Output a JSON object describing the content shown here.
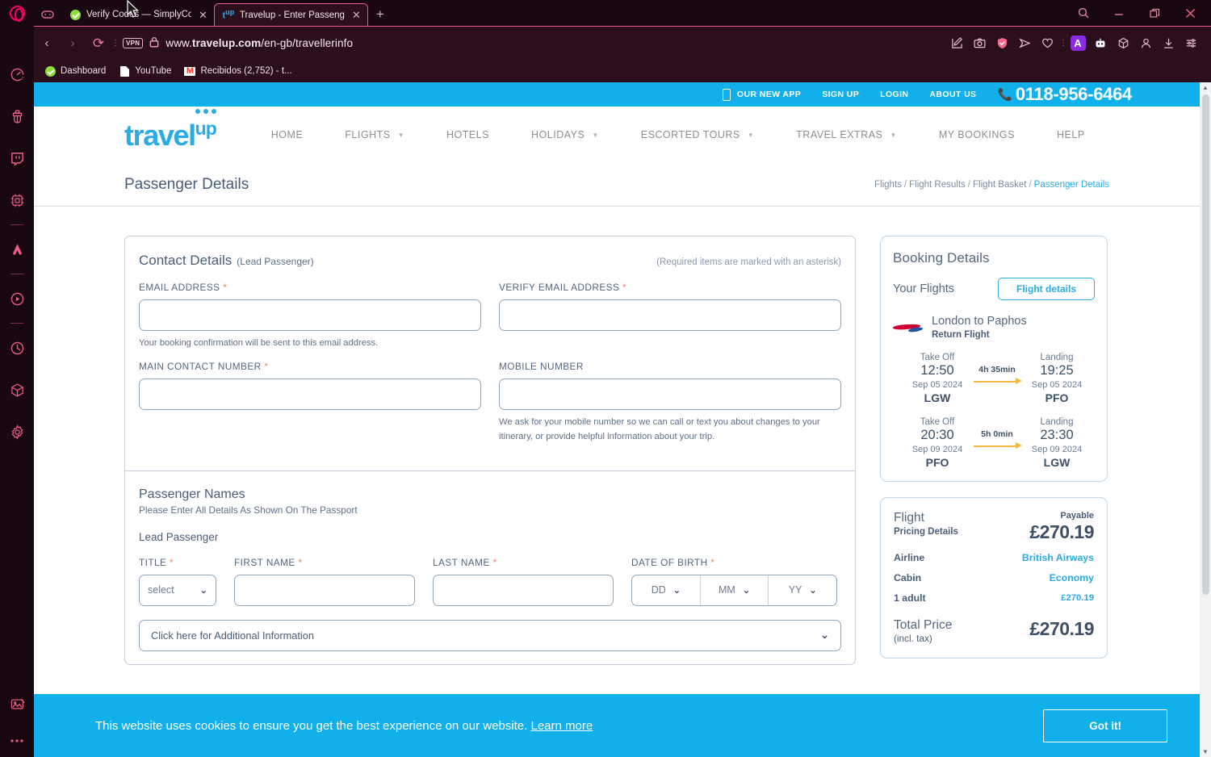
{
  "browser": {
    "tabs": [
      {
        "title": "Verify Codes — SimplyCod",
        "favicon": "green-check-icon",
        "active": false
      },
      {
        "title": "Travelup - Enter Passenger",
        "favicon": "travelup-icon",
        "active": true
      }
    ],
    "new_tab_label": "+",
    "window_controls": {
      "search": "search-icon",
      "minimize": "minimize-icon",
      "restore": "restore-icon",
      "close": "close-icon"
    },
    "nav": {
      "back": "back-icon",
      "forward": "forward-icon",
      "reload": "reload-icon",
      "vpn_badge": "VPN",
      "lock": "lock-icon",
      "url_prefix": "www.",
      "url_domain": "travelup.com",
      "url_path": "/en-gb/travellerinfo"
    },
    "bookmarks": [
      {
        "label": "Dashboard",
        "icon": "green-check-icon"
      },
      {
        "label": "YouTube",
        "icon": "document-icon"
      },
      {
        "label": "Recibidos (2,752) - t...",
        "icon": "gmail-icon"
      }
    ],
    "toolbar_icons": [
      "edit-page-icon",
      "snapshot-icon",
      "ad-block-shield-icon",
      "send-icon",
      "heart-icon",
      "extension-a-icon",
      "aria-bot-icon",
      "cube-icon",
      "profile-icon",
      "download-icon",
      "settings-sliders-icon"
    ],
    "sidebar_icons": [
      "speedometer-icon",
      "clean-brush-icon",
      "twitch-icon",
      "cpu-icon",
      "messenger-icon",
      "player-icon",
      "history-icon",
      "cube-icon",
      "gear-icon",
      "image-off-icon",
      "more-dots-icon"
    ]
  },
  "site": {
    "topbar": {
      "app_label": "OUR NEW APP",
      "signup": "SIGN UP",
      "login": "LOGIN",
      "about": "ABOUT US",
      "phone": "0118-956-6464"
    },
    "logo": {
      "travel": "travel",
      "up": "up"
    },
    "nav": [
      {
        "label": "HOME",
        "caret": false
      },
      {
        "label": "FLIGHTS",
        "caret": true
      },
      {
        "label": "HOTELS",
        "caret": false
      },
      {
        "label": "HOLIDAYS",
        "caret": true
      },
      {
        "label": "ESCORTED TOURS",
        "caret": true
      },
      {
        "label": "TRAVEL EXTRAS",
        "caret": true
      },
      {
        "label": "MY BOOKINGS",
        "caret": false
      },
      {
        "label": "HELP",
        "caret": false
      }
    ],
    "page_title": "Passenger Details",
    "breadcrumbs": [
      "Flights",
      "Flight Results",
      "Flight Basket",
      "Passenger Details"
    ]
  },
  "contact": {
    "title": "Contact Details",
    "subtitle": "(Lead Passenger)",
    "required_note": "(Required items are marked with an asterisk)",
    "email_label": "EMAIL ADDRESS",
    "email_value": "",
    "email_hint": "Your booking confirmation will be sent to this email address.",
    "verify_email_label": "VERIFY EMAIL ADDRESS",
    "verify_email_value": "",
    "main_contact_label": "MAIN CONTACT NUMBER",
    "main_contact_value": "",
    "mobile_label": "MOBILE NUMBER",
    "mobile_value": "",
    "mobile_hint": "We ask for your mobile number so we can call or text you about changes to your itinerary, or provide helpful information about your trip."
  },
  "passenger": {
    "section_title": "Passenger Names",
    "section_sub": "Please Enter All Details As Shown On The Passport",
    "lead_label": "Lead Passenger",
    "title_label": "TITLE",
    "title_value": "select",
    "first_label": "FIRST NAME",
    "first_value": "",
    "last_label": "LAST NAME",
    "last_value": "",
    "dob_label": "DATE OF BIRTH",
    "dob_day": "DD",
    "dob_month": "MM",
    "dob_year": "YY",
    "additional_info": "Click here for Additional Information"
  },
  "booking": {
    "title": "Booking Details",
    "your_flights": "Your Flights",
    "flight_details_btn": "Flight details",
    "route": "London to Paphos",
    "route_type": "Return Flight",
    "legs": [
      {
        "takeoff_label": "Take Off",
        "takeoff_time": "12:50",
        "takeoff_date": "Sep 05 2024",
        "takeoff_code": "LGW",
        "duration": "4h 35min",
        "landing_label": "Landing",
        "landing_time": "19:25",
        "landing_date": "Sep 05 2024",
        "landing_code": "PFO"
      },
      {
        "takeoff_label": "Take Off",
        "takeoff_time": "20:30",
        "takeoff_date": "Sep 09 2024",
        "takeoff_code": "PFO",
        "duration": "5h 0min",
        "landing_label": "Landing",
        "landing_time": "23:30",
        "landing_date": "Sep 09 2024",
        "landing_code": "LGW"
      }
    ]
  },
  "pricing": {
    "flight_label": "Flight",
    "pricing_details_label": "Pricing Details",
    "payable_label": "Payable",
    "payable_amount": "£270.19",
    "airline_key": "Airline",
    "airline_value": "British Airways",
    "cabin_key": "Cabin",
    "cabin_value": "Economy",
    "pax_key": "1 adult",
    "pax_value": "£270.19",
    "total_label": "Total Price",
    "total_sub": "(incl. tax)",
    "total_amount": "£270.19"
  },
  "cookie": {
    "message": "This website uses cookies to ensure you get the best experience on our website.",
    "learn_more": "Learn more",
    "accept": "Got it!"
  },
  "colors": {
    "brand_blue": "#11b0ea",
    "accent_link": "#2aabe4",
    "label_slate": "#52667f",
    "asterisk_orange": "#ef8163",
    "browser_pink": "#f0569a"
  }
}
